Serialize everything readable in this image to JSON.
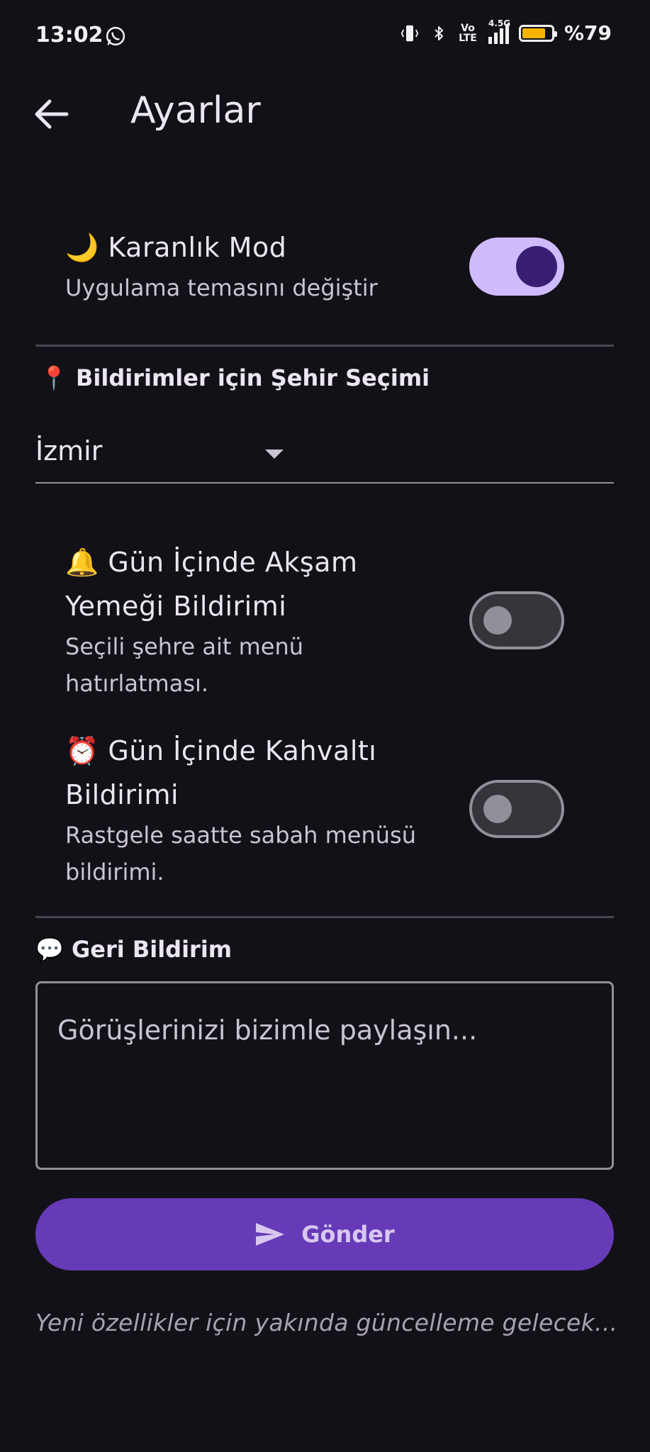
{
  "status_bar": {
    "time": "13:02",
    "network_label": "4.5G",
    "volte_label": "Vo LTE",
    "battery_text": "%79",
    "battery_level": 0.79,
    "battery_color": "#f4b400"
  },
  "app_bar": {
    "title": "Ayarlar",
    "back_icon": "arrow-left-icon"
  },
  "dark_mode": {
    "emoji": "🌙",
    "title": "Karanlık Mod",
    "subtitle": "Uygulama temasını değiştir",
    "enabled": true
  },
  "city_section": {
    "emoji": "📍",
    "title": "Bildirimler için Şehir Seçimi",
    "selected_city": "İzmir"
  },
  "dinner_notification": {
    "emoji": "🔔",
    "title_line1": "Gün İçinde Akşam",
    "title_line2": "Yemeği Bildirimi",
    "subtitle_line1": "Seçili şehre ait menü",
    "subtitle_line2": "hatırlatması.",
    "enabled": false
  },
  "breakfast_notification": {
    "emoji": "⏰",
    "title_line1": "Gün İçinde Kahvaltı",
    "title_line2": "Bildirimi",
    "subtitle_line1": "Rastgele saatte sabah menüsü",
    "subtitle_line2": "bildirimi.",
    "enabled": false
  },
  "feedback": {
    "emoji": "💬",
    "title": "Geri Bildirim",
    "placeholder": "Görüşlerinizi bizimle paylaşın...",
    "value": "",
    "send_label": "Gönder",
    "send_icon": "send-icon"
  },
  "footer_note": "Yeni özellikler için yakında güncelleme gelecek...",
  "colors": {
    "background": "#131118",
    "accent": "#673ab7",
    "switch_on": "#cfbcff",
    "switch_knob_on": "#381e72"
  }
}
